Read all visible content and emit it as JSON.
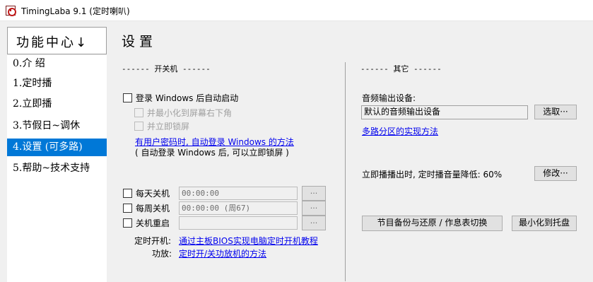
{
  "window": {
    "title": "TimingLaba 9.1 (定时喇叭)"
  },
  "sidebar": {
    "header": "功能中心↓",
    "items": [
      {
        "label": "0.介 绍"
      },
      {
        "label": "1.定时播"
      },
      {
        "label": "2.立即播"
      },
      {
        "label": "3.节假日~调休"
      },
      {
        "label": "4.设置 (可多路)",
        "active": true
      },
      {
        "label": "5.帮助~技术支持"
      }
    ]
  },
  "page": {
    "title": "设置"
  },
  "power": {
    "section_label": "------ 开关机 ------",
    "autostart_label": "登录 Windows 后自动启动",
    "minimize_label": "并最小化到屏幕右下角",
    "lock_label": "并立即锁屏",
    "autologin_link": "有用户密码时, 自动登录 Windows 的方法",
    "autologin_note": "( 自动登录 Windows 后, 可以立即锁屏 )",
    "daily_shutdown": {
      "label": "每天关机",
      "value": "00:00:00",
      "button": "···"
    },
    "weekly_shutdown": {
      "label": "每周关机",
      "value": "00:00:00 (周67)",
      "button": "···"
    },
    "restart": {
      "label": "关机重启",
      "value": "",
      "button": "···"
    },
    "timed_boot_label": "定时开机:",
    "timed_boot_link": "通过主板BIOS实现电脑定时开机教程",
    "amp_label": "功放:",
    "amp_link": "定时开/关功放机的方法"
  },
  "other": {
    "section_label": "------ 其它 ------",
    "audio_device_label": "音频输出设备:",
    "audio_device_value": "默认的音频输出设备",
    "select_button": "选取···",
    "multi_zone_link": "多路分区的实现方法",
    "volume_text": "立即播播出时, 定时播音量降低: 60%",
    "modify_button": "修改···",
    "backup_button": "节目备份与还原 / 作息表切换",
    "minimize_tray_button": "最小化到托盘"
  }
}
